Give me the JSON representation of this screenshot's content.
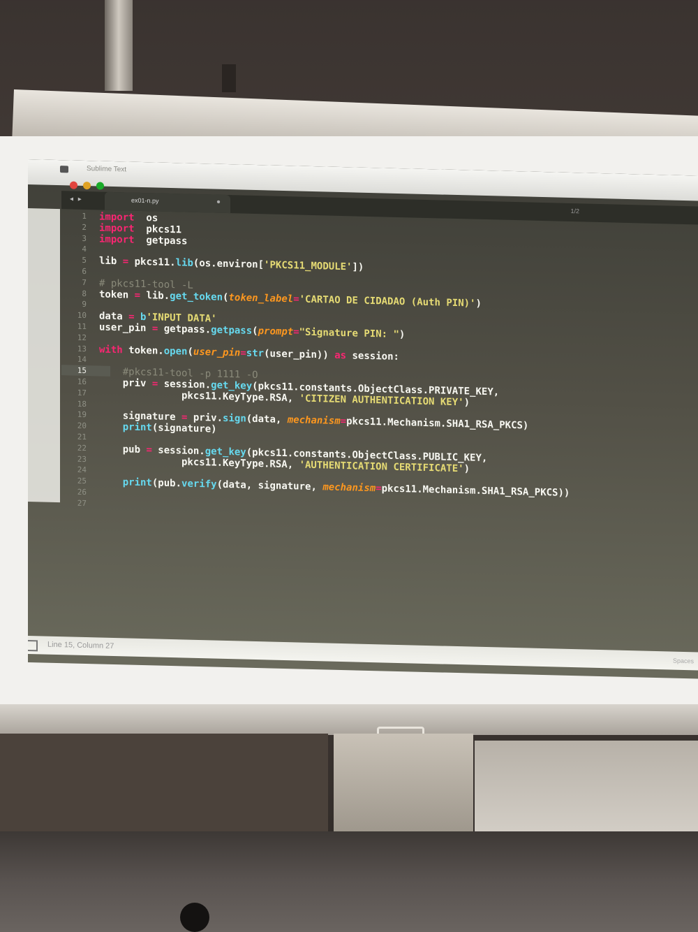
{
  "app": {
    "title": "Sublime Text",
    "tab": "ex01-n.py",
    "corner": "1/2"
  },
  "colors": {
    "keyword": "#f92672",
    "function": "#66d9ef",
    "string": "#e6db74",
    "argument": "#fd971f",
    "comment": "#8a8a7a",
    "text": "#f8f8f2"
  },
  "editor": {
    "current_line": 15,
    "lines": [
      {
        "n": "1",
        "segs": [
          [
            "kw",
            "import"
          ],
          [
            "",
            "  os"
          ]
        ]
      },
      {
        "n": "2",
        "segs": [
          [
            "kw",
            "import"
          ],
          [
            "",
            "  pkcs11"
          ]
        ]
      },
      {
        "n": "3",
        "segs": [
          [
            "kw",
            "import"
          ],
          [
            "",
            "  getpass"
          ]
        ]
      },
      {
        "n": "4",
        "segs": []
      },
      {
        "n": "5",
        "segs": [
          [
            "",
            "lib "
          ],
          [
            "kw",
            "="
          ],
          [
            "",
            " pkcs11."
          ],
          [
            "fn",
            "lib"
          ],
          [
            "",
            "(os.environ["
          ],
          [
            "str",
            "'PKCS11_MODULE'"
          ],
          [
            "",
            "])"
          ]
        ]
      },
      {
        "n": "6",
        "segs": []
      },
      {
        "n": "7",
        "segs": [
          [
            "cm",
            "# pkcs11-tool -L"
          ]
        ]
      },
      {
        "n": "8",
        "segs": [
          [
            "",
            "token "
          ],
          [
            "kw",
            "="
          ],
          [
            "",
            " lib."
          ],
          [
            "fn",
            "get_token"
          ],
          [
            "",
            "("
          ],
          [
            "arg",
            "token_label"
          ],
          [
            "kw",
            "="
          ],
          [
            "str",
            "'CARTAO DE CIDADAO (Auth PIN)'"
          ],
          [
            "",
            ")"
          ]
        ]
      },
      {
        "n": "9",
        "segs": []
      },
      {
        "n": "10",
        "segs": [
          [
            "",
            "data "
          ],
          [
            "kw",
            "="
          ],
          [
            "",
            " "
          ],
          [
            "fn",
            "b"
          ],
          [
            "str",
            "'INPUT DATA'"
          ]
        ]
      },
      {
        "n": "11",
        "segs": [
          [
            "",
            "user_pin "
          ],
          [
            "kw",
            "="
          ],
          [
            "",
            " getpass."
          ],
          [
            "fn",
            "getpass"
          ],
          [
            "",
            "("
          ],
          [
            "arg",
            "prompt"
          ],
          [
            "kw",
            "="
          ],
          [
            "str",
            "\"Signature PIN: \""
          ],
          [
            "",
            ")"
          ]
        ]
      },
      {
        "n": "12",
        "segs": []
      },
      {
        "n": "13",
        "segs": [
          [
            "kw",
            "with"
          ],
          [
            "",
            " token."
          ],
          [
            "fn",
            "open"
          ],
          [
            "",
            "("
          ],
          [
            "arg",
            "user_pin"
          ],
          [
            "kw",
            "="
          ],
          [
            "fn",
            "str"
          ],
          [
            "",
            "(user_pin)) "
          ],
          [
            "kw",
            "as"
          ],
          [
            "",
            " session:"
          ]
        ]
      },
      {
        "n": "14",
        "segs": []
      },
      {
        "n": "15",
        "segs": [
          [
            "",
            "    "
          ],
          [
            "cm",
            "#pkcs11-tool -p 1111 -O"
          ]
        ]
      },
      {
        "n": "16",
        "segs": [
          [
            "",
            "    priv "
          ],
          [
            "kw",
            "="
          ],
          [
            "",
            " session."
          ],
          [
            "fn",
            "get_key"
          ],
          [
            "",
            "(pkcs11.constants.ObjectClass.PRIVATE_KEY,"
          ]
        ]
      },
      {
        "n": "17",
        "segs": [
          [
            "",
            "              pkcs11.KeyType.RSA, "
          ],
          [
            "str",
            "'CITIZEN AUTHENTICATION KEY'"
          ],
          [
            "",
            ")"
          ]
        ]
      },
      {
        "n": "18",
        "segs": []
      },
      {
        "n": "19",
        "segs": [
          [
            "",
            "    signature "
          ],
          [
            "kw",
            "="
          ],
          [
            "",
            " priv."
          ],
          [
            "fn",
            "sign"
          ],
          [
            "",
            "(data, "
          ],
          [
            "arg",
            "mechanism"
          ],
          [
            "kw",
            "="
          ],
          [
            "",
            "pkcs11.Mechanism.SHA1_RSA_PKCS)"
          ]
        ]
      },
      {
        "n": "20",
        "segs": [
          [
            "",
            "    "
          ],
          [
            "fn",
            "print"
          ],
          [
            "",
            "(signature)"
          ]
        ]
      },
      {
        "n": "21",
        "segs": []
      },
      {
        "n": "22",
        "segs": [
          [
            "",
            "    pub "
          ],
          [
            "kw",
            "="
          ],
          [
            "",
            " session."
          ],
          [
            "fn",
            "get_key"
          ],
          [
            "",
            "(pkcs11.constants.ObjectClass.PUBLIC_KEY,"
          ]
        ]
      },
      {
        "n": "23",
        "segs": [
          [
            "",
            "              pkcs11.KeyType.RSA, "
          ],
          [
            "str",
            "'AUTHENTICATION CERTIFICATE'"
          ],
          [
            "",
            ")"
          ]
        ]
      },
      {
        "n": "24",
        "segs": []
      },
      {
        "n": "25",
        "segs": [
          [
            "",
            "    "
          ],
          [
            "fn",
            "print"
          ],
          [
            "",
            "(pub."
          ],
          [
            "fn",
            "verify"
          ],
          [
            "",
            "(data, signature, "
          ],
          [
            "arg",
            "mechanism"
          ],
          [
            "kw",
            "="
          ],
          [
            "",
            "pkcs11.Mechanism.SHA1_RSA_PKCS))"
          ]
        ]
      },
      {
        "n": "26",
        "segs": []
      },
      {
        "n": "27",
        "segs": []
      }
    ]
  },
  "status": {
    "position": "Line 15, Column 27",
    "right": "Spaces"
  }
}
